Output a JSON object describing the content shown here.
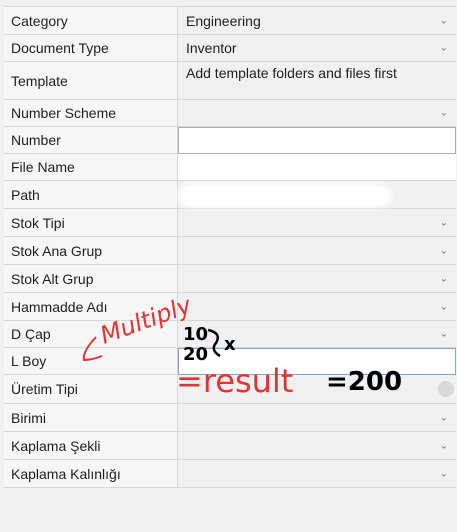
{
  "rows": [
    {
      "label": "Category",
      "value": "Engineering"
    },
    {
      "label": "Document Type",
      "value": "Inventor"
    },
    {
      "label": "Template",
      "value": "Add template folders and files first"
    },
    {
      "label": "Number Scheme",
      "value": ""
    },
    {
      "label": "Number",
      "value": ""
    },
    {
      "label": "File Name",
      "value": ""
    },
    {
      "label": "Path",
      "value": ""
    },
    {
      "label": "Stok Tipi",
      "value": ""
    },
    {
      "label": "Stok Ana Grup",
      "value": ""
    },
    {
      "label": "Stok Alt Grup",
      "value": ""
    },
    {
      "label": "Hammadde Adı",
      "value": ""
    },
    {
      "label": "D Çap",
      "value": ""
    },
    {
      "label": "L Boy",
      "value": ""
    },
    {
      "label": "Üretim Tipi",
      "value": ""
    },
    {
      "label": "Birimi",
      "value": ""
    },
    {
      "label": "Kaplama Şekli",
      "value": ""
    },
    {
      "label": "Kaplama Kalınlığı",
      "value": ""
    }
  ],
  "annotations": {
    "multiply": "Multiply",
    "num1": "10",
    "num2": "20",
    "times": "x",
    "result": "=result",
    "equals": "=200"
  },
  "colors": {
    "annotation_red": "#e03535",
    "annotation_black": "#000000",
    "chevron": "#7a7a7a"
  },
  "icons": {
    "dropdown": "chevron-down-icon"
  }
}
